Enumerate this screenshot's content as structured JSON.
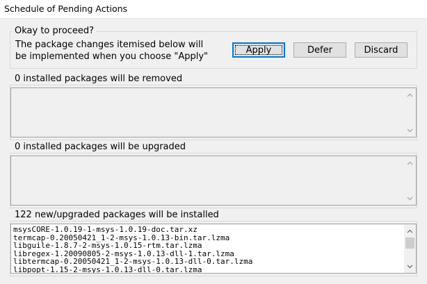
{
  "window": {
    "title": "Schedule of Pending Actions"
  },
  "proceed": {
    "heading": "Okay to proceed?",
    "line1": "The package changes itemised below will",
    "line2": "be implemented when you choose \"Apply\"",
    "buttons": {
      "apply": "Apply",
      "defer": "Defer",
      "discard": "Discard"
    }
  },
  "removed": {
    "heading": "0 installed packages will be removed"
  },
  "upgraded": {
    "heading": "0 installed packages will be upgraded"
  },
  "installed": {
    "heading": "122 new/upgraded packages will be installed",
    "items": [
      "msysCORE-1.0.19-1-msys-1.0.19-doc.tar.xz",
      "termcap-0.20050421_1-2-msys-1.0.13-bin.tar.lzma",
      "libguile-1.8.7-2-msys-1.0.15-rtm.tar.lzma",
      "libregex-1.20090805-2-msys-1.0.13-dll-1.tar.lzma",
      "libtermcap-0.20050421_1-2-msys-1.0.13-dll-0.tar.lzma",
      "libpopt-1.15-2-msys-1.0.13-dll-0.tar.lzma"
    ]
  },
  "icons": {
    "scroll_up": "chevron-up-icon",
    "scroll_down": "chevron-down-icon"
  },
  "colors": {
    "focus_border": "#0078d7",
    "window_bg": "#f0f0f0"
  }
}
